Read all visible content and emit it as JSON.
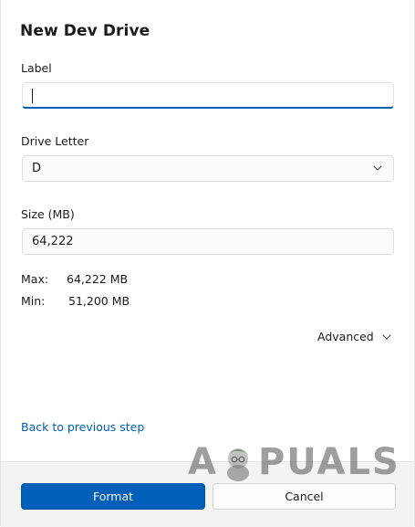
{
  "dialog": {
    "title": "New Dev Drive"
  },
  "label_field": {
    "label": "Label",
    "value": ""
  },
  "drive_letter": {
    "label": "Drive Letter",
    "selected": "D"
  },
  "size_field": {
    "label": "Size (MB)",
    "value": "64,222"
  },
  "limits": {
    "max_label": "Max:",
    "max_value": "64,222 MB",
    "min_label": "Min:",
    "min_value": "51,200 MB"
  },
  "advanced": {
    "label": "Advanced"
  },
  "back_link": {
    "label": "Back to previous step"
  },
  "buttons": {
    "format": "Format",
    "cancel": "Cancel"
  },
  "watermark": {
    "left": "A",
    "right": "PUALS"
  },
  "colors": {
    "accent": "#005fb8",
    "footer_bg": "#f3f3f3"
  },
  "icons": {
    "select_chevron": "chevron-down-icon",
    "advanced_chevron": "chevron-down-icon"
  }
}
